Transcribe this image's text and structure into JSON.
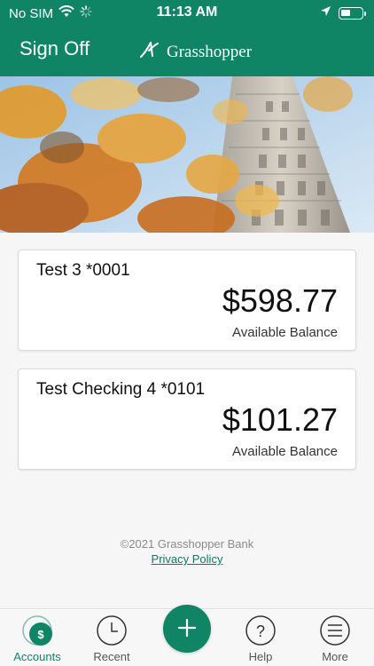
{
  "status_bar": {
    "carrier": "No SIM",
    "time": "11:13 AM"
  },
  "app_bar": {
    "sign_off_label": "Sign Off",
    "logo_text": "Grasshopper"
  },
  "accounts": [
    {
      "name": "Test 3 *0001",
      "balance": "$598.77",
      "balance_label": "Available Balance"
    },
    {
      "name": "Test Checking 4 *0101",
      "balance": "$101.27",
      "balance_label": "Available Balance"
    }
  ],
  "footer": {
    "copyright": "©2021 Grasshopper Bank",
    "privacy_link": "Privacy Policy"
  },
  "tabs": [
    {
      "label": "Accounts",
      "icon": "dollar-circle-icon",
      "active": true
    },
    {
      "label": "Recent",
      "icon": "clock-icon",
      "active": false
    },
    {
      "label": "Help",
      "icon": "question-circle-icon",
      "active": false
    },
    {
      "label": "More",
      "icon": "menu-circle-icon",
      "active": false
    }
  ],
  "colors": {
    "brand_green": "#0f8566",
    "background": "#f6f6f6",
    "footer_text": "#8b8b8b"
  }
}
